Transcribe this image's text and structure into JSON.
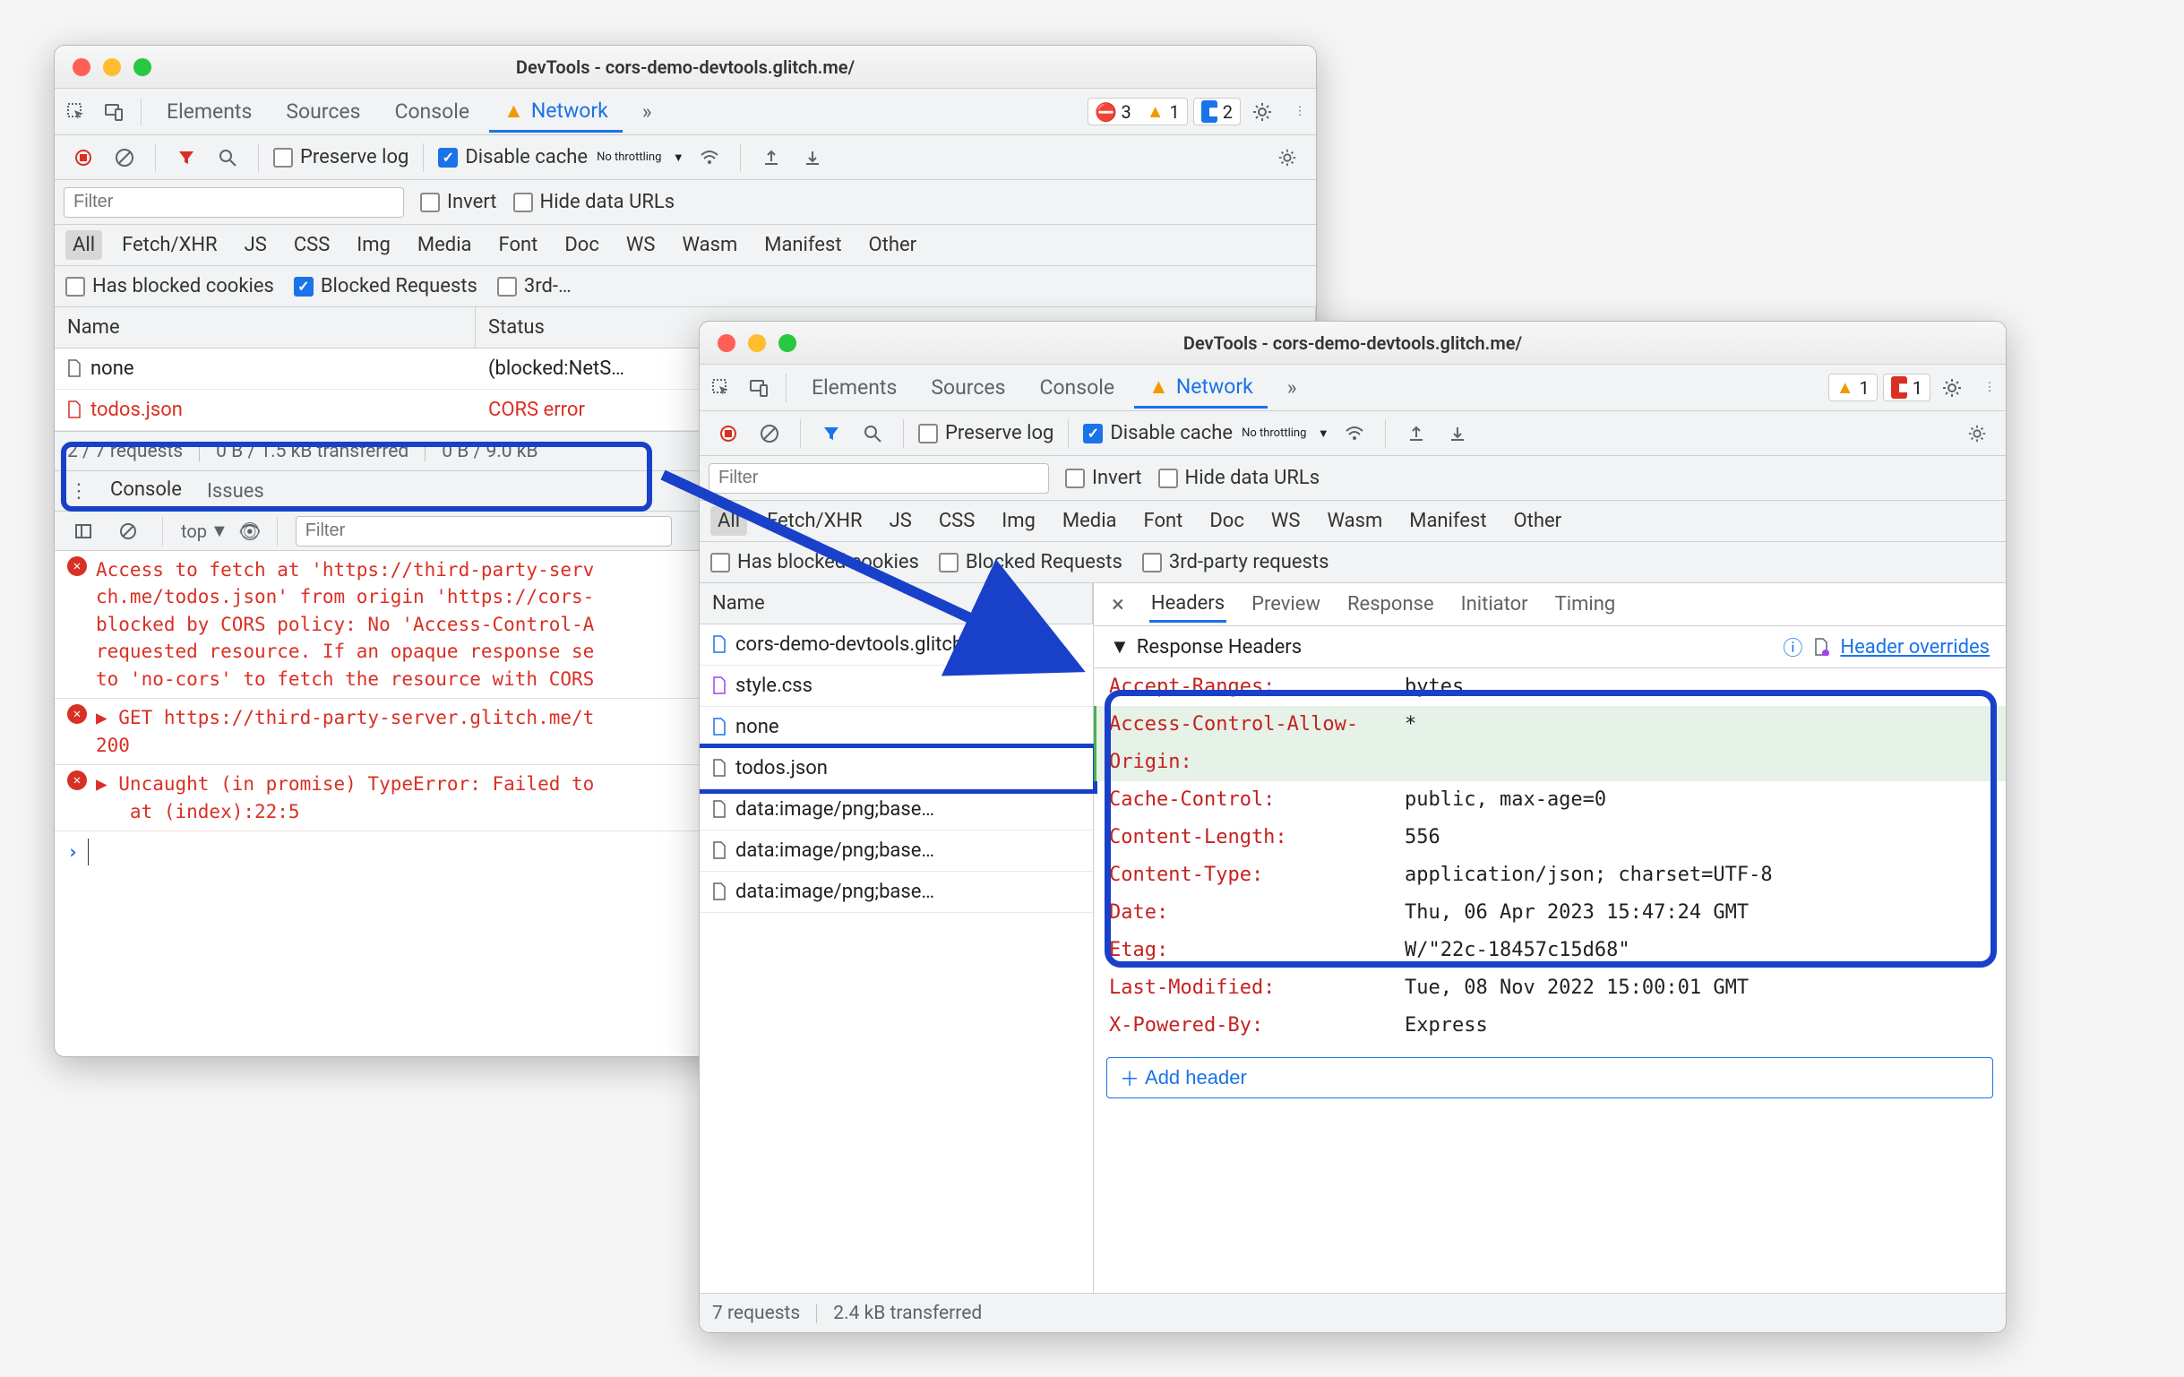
{
  "win1": {
    "title": "DevTools - cors-demo-devtools.glitch.me/",
    "tabs": {
      "elements": "Elements",
      "sources": "Sources",
      "console": "Console",
      "network": "Network",
      "more": "»"
    },
    "counts": {
      "errors": "3",
      "warnings": "1",
      "issues": "2"
    },
    "toolbar": {
      "preserve_log": "Preserve log",
      "disable_cache": "Disable cache",
      "throttling": "No throttling"
    },
    "filter_placeholder": "Filter",
    "invert": "Invert",
    "hide_urls": "Hide data URLs",
    "chipset": [
      "All",
      "Fetch/XHR",
      "JS",
      "CSS",
      "Img",
      "Media",
      "Font",
      "Doc",
      "WS",
      "Wasm",
      "Manifest",
      "Other"
    ],
    "blocked_cookies": "Has blocked cookies",
    "blocked_requests": "Blocked Requests",
    "third_party": "3rd-…",
    "table": {
      "th_name": "Name",
      "th_status": "Status",
      "rows": [
        {
          "name": "none",
          "status": "(blocked:NetS…",
          "kind": "plain"
        },
        {
          "name": "todos.json",
          "status": "CORS error",
          "kind": "error"
        }
      ]
    },
    "footer": {
      "requests": "2 / 7 requests",
      "transferred": "0 B / 1.5 kB transferred",
      "resources": "0 B / 9.0 kB"
    },
    "drawer": {
      "console": "Console",
      "issues": "Issues"
    },
    "ctoolbar": {
      "top": "top",
      "filter": "Filter"
    },
    "console": [
      "Access to fetch at 'https://third-party-serv\nch.me/todos.json' from origin 'https://cors-\nblocked by CORS policy: No 'Access-Control-A\nrequested resource. If an opaque response se\nto 'no-cors' to fetch the resource with CORS",
      "▶ GET https://third-party-server.glitch.me/t\n200",
      "▶ Uncaught (in promise) TypeError: Failed to\n   at (index):22:5"
    ]
  },
  "win2": {
    "title": "DevTools - cors-demo-devtools.glitch.me/",
    "tabs": {
      "elements": "Elements",
      "sources": "Sources",
      "console": "Console",
      "network": "Network",
      "more": "»"
    },
    "counts": {
      "warnings": "1",
      "issues": "1"
    },
    "toolbar": {
      "preserve_log": "Preserve log",
      "disable_cache": "Disable cache",
      "throttling": "No throttling"
    },
    "filter_placeholder": "Filter",
    "invert": "Invert",
    "hide_urls": "Hide data URLs",
    "chipset": [
      "All",
      "Fetch/XHR",
      "JS",
      "CSS",
      "Img",
      "Media",
      "Font",
      "Doc",
      "WS",
      "Wasm",
      "Manifest",
      "Other"
    ],
    "blocked_cookies": "Has blocked cookies",
    "blocked_requests": "Blocked Requests",
    "third_party": "3rd-party requests",
    "table": {
      "th_name": "Name",
      "rows": [
        {
          "name": "cors-demo-devtools.glitch.me",
          "icon": "doc"
        },
        {
          "name": "style.css",
          "icon": "css"
        },
        {
          "name": "none",
          "icon": "doc"
        },
        {
          "name": "todos.json",
          "icon": "file",
          "selected": true
        },
        {
          "name": "data:image/png;base…",
          "icon": "img"
        },
        {
          "name": "data:image/png;base…",
          "icon": "img"
        },
        {
          "name": "data:image/png;base…",
          "icon": "img"
        }
      ]
    },
    "footer": {
      "requests": "7 requests",
      "transferred": "2.4 kB transferred"
    },
    "side_tabs": {
      "headers": "Headers",
      "preview": "Preview",
      "response": "Response",
      "initiator": "Initiator",
      "timing": "Timing",
      "close": "×"
    },
    "section_title": "Response Headers",
    "overrides_link": "Header overrides",
    "headers": [
      {
        "name": "Accept-Ranges:",
        "value": "bytes",
        "override": false
      },
      {
        "name": "Access-Control-Allow-Origin:",
        "value": "*",
        "override": true
      },
      {
        "name": "Cache-Control:",
        "value": "public, max-age=0",
        "override": false
      },
      {
        "name": "Content-Length:",
        "value": "556",
        "override": false
      },
      {
        "name": "Content-Type:",
        "value": "application/json; charset=UTF-8",
        "override": false
      },
      {
        "name": "Date:",
        "value": "Thu, 06 Apr 2023 15:47:24 GMT",
        "override": false
      },
      {
        "name": "Etag:",
        "value": "W/\"22c-18457c15d68\"",
        "override": false
      },
      {
        "name": "Last-Modified:",
        "value": "Tue, 08 Nov 2022 15:00:01 GMT",
        "override": false
      },
      {
        "name": "X-Powered-By:",
        "value": "Express",
        "override": false
      }
    ],
    "add_header": "Add header"
  }
}
